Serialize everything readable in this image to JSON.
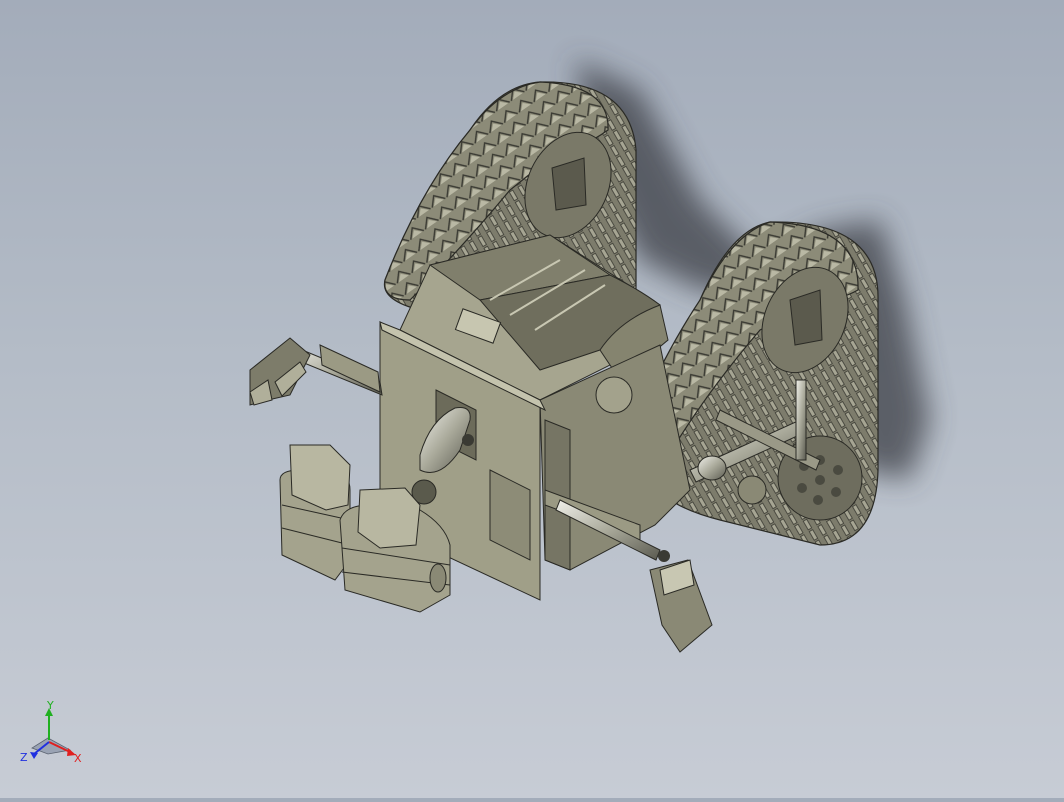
{
  "scene": {
    "model_name": "tracked-robot-assembly",
    "background_top": "#a3acba",
    "background_bottom": "#c7ccd5",
    "body_color": "#9b9a80",
    "track_color": "#8e8d7b",
    "shadow_color": "#3c3f47"
  },
  "triad": {
    "x_label": "X",
    "y_label": "Y",
    "z_label": "Z",
    "x_color": "#e02020",
    "y_color": "#20b020",
    "z_color": "#2030e0"
  }
}
